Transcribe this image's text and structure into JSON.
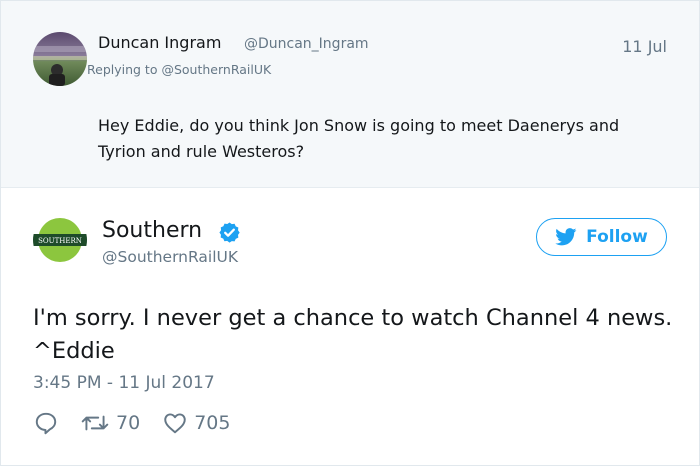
{
  "reply": {
    "author_name": "Duncan Ingram",
    "author_handle": "@Duncan_Ingram",
    "date": "11 Jul",
    "replying_to_prefix": "Replying to",
    "replying_to_handle": "@SouthernRailUK",
    "text": "Hey Eddie, do you think Jon Snow is going to meet Daenerys and Tyrion and rule Westeros?"
  },
  "tweet": {
    "author_name": "Southern",
    "author_handle": "@SouthernRailUK",
    "avatar_logo_text": "SOUTHERN",
    "follow_label": "Follow",
    "text": "I'm sorry. I never get a chance to watch Channel 4 news. ^Eddie",
    "timestamp": "3:45 PM - 11 Jul 2017",
    "retweet_count": "70",
    "like_count": "705"
  },
  "icons": {
    "verified": "verified-badge-icon",
    "follow": "twitter-bird-icon",
    "reply": "reply-bubble-icon",
    "retweet": "retweet-icon",
    "like": "heart-icon"
  },
  "colors": {
    "accent": "#1da1f2",
    "secondary_text": "#657786",
    "reply_background": "#f5f8fa",
    "logo_green": "#8cc63e",
    "logo_dark_green": "#1e4b2a"
  }
}
